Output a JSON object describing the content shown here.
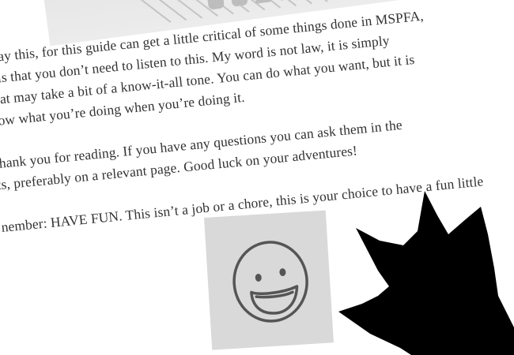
{
  "guide": {
    "paragraphs": [
      {
        "lines": [
          "t say this, for this guide can get a little critical of some things done in MSPFA,",
          "g is that you don’t need to listen to this. My word is not law, it is simply",
          "that may take a bit of a know-it-all tone. You can do what you want, but it is",
          "now what you’re doing when you’re doing it."
        ]
      },
      {
        "lines": [
          "thank you for reading. If you have any questions you can ask them in the",
          "ts, preferably on a relevant page. Good luck on your adventures!"
        ]
      },
      {
        "lines": [
          "nember: HAVE FUN. This isn’t a job or a chore, this is your choice to have a fun little"
        ]
      }
    ]
  },
  "images": {
    "banner": {
      "description_icon": "banner-image"
    },
    "smiley": {
      "icon": "smiley-face-icon",
      "background": "#d9d9d9",
      "stroke": "#555555"
    },
    "spiky": {
      "icon": "black-spiky-shape",
      "fill": "#000000"
    }
  },
  "colors": {
    "text": "#333333",
    "background": "#ffffff"
  }
}
